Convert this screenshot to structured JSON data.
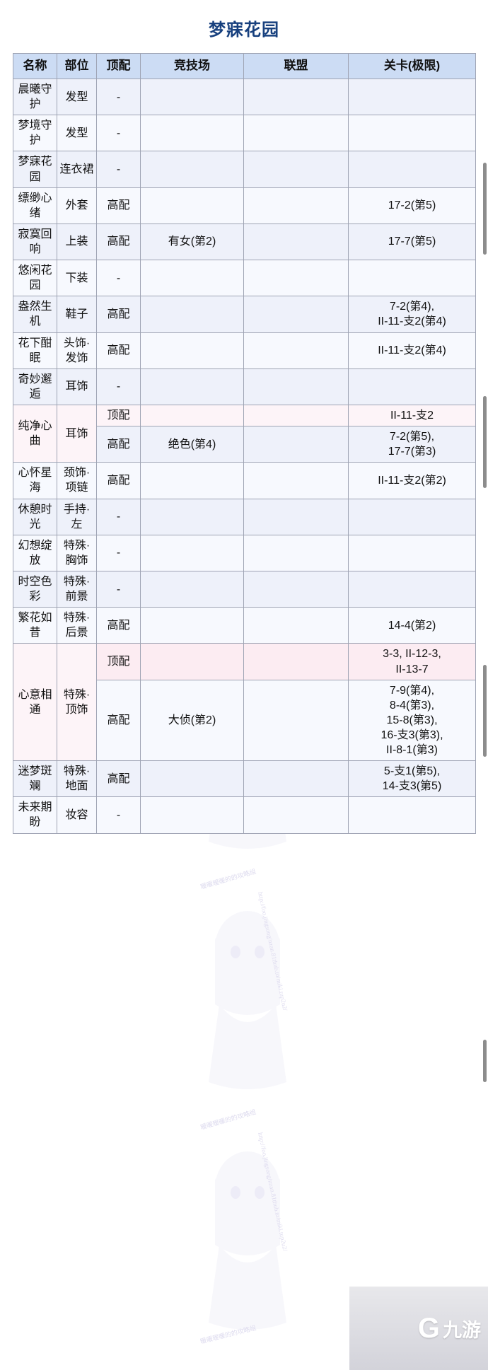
{
  "page": {
    "title": "梦寐花园",
    "title_color": "#17407e",
    "highlight_color": "#e8112d"
  },
  "table": {
    "headers": [
      "名称",
      "部位",
      "顶配",
      "竞技场",
      "联盟",
      "关卡(极限)"
    ],
    "rows": [
      {
        "name": "晨曦守护",
        "part": "发型",
        "top": "-",
        "arena": "",
        "league": "",
        "stage": ""
      },
      {
        "name": "梦境守护",
        "part": "发型",
        "top": "-",
        "arena": "",
        "league": "",
        "stage": ""
      },
      {
        "name": "梦寐花园",
        "part": "连衣裙",
        "top": "-",
        "arena": "",
        "league": "",
        "stage": ""
      },
      {
        "name": "缥缈心绪",
        "part": "外套",
        "top": "高配",
        "arena": "",
        "league": "",
        "stage": "17-2(第5)"
      },
      {
        "name": "寂寞回响",
        "part": "上装",
        "top": "高配",
        "arena": "有女(第2)",
        "league": "",
        "stage": "17-7(第5)"
      },
      {
        "name": "悠闲花园",
        "part": "下装",
        "top": "-",
        "arena": "",
        "league": "",
        "stage": ""
      },
      {
        "name": "盎然生机",
        "part": "鞋子",
        "top": "高配",
        "arena": "",
        "league": "",
        "stage": "7-2(第4),\nII-11-支2(第4)"
      },
      {
        "name": "花下酣眠",
        "part": "头饰·发饰",
        "top": "高配",
        "arena": "",
        "league": "",
        "stage": "II-11-支2(第4)"
      },
      {
        "name": "奇妙邂逅",
        "part": "耳饰",
        "top": "-",
        "arena": "",
        "league": "",
        "stage": ""
      },
      {
        "name": "纯净心曲",
        "part": "耳饰",
        "highlight": true,
        "sub": [
          {
            "top": "顶配",
            "arena": "",
            "league": "",
            "stage": "II-11-支2",
            "highlight": true
          },
          {
            "top": "高配",
            "arena": "绝色(第4)",
            "league": "",
            "stage": "7-2(第5),\n17-7(第3)",
            "highlight": false
          }
        ]
      },
      {
        "name": "心怀星海",
        "part": "颈饰·项链",
        "top": "高配",
        "arena": "",
        "league": "",
        "stage": "II-11-支2(第2)"
      },
      {
        "name": "休憩时光",
        "part": "手持·左",
        "top": "-",
        "arena": "",
        "league": "",
        "stage": ""
      },
      {
        "name": "幻想绽放",
        "part": "特殊·胸饰",
        "top": "-",
        "arena": "",
        "league": "",
        "stage": ""
      },
      {
        "name": "时空色彩",
        "part": "特殊·前景",
        "top": "-",
        "arena": "",
        "league": "",
        "stage": ""
      },
      {
        "name": "繁花如昔",
        "part": "特殊·后景",
        "top": "高配",
        "arena": "",
        "league": "",
        "stage": "14-4(第2)"
      },
      {
        "name": "心意相通",
        "part": "特殊·顶饰",
        "highlight": true,
        "sub": [
          {
            "top": "顶配",
            "arena": "",
            "league": "",
            "stage": "3-3, II-12-3,\nII-13-7",
            "highlight": true
          },
          {
            "top": "高配",
            "arena": "大侦(第2)",
            "league": "",
            "stage": "7-9(第4),\n8-4(第3),\n15-8(第3),\n16-支3(第3),\nII-8-1(第3)",
            "highlight": false
          }
        ]
      },
      {
        "name": "迷梦斑斓",
        "part": "特殊·地面",
        "top": "高配",
        "arena": "",
        "league": "",
        "stage": "5-支1(第5),\n14-支3(第5)"
      },
      {
        "name": "未来期盼",
        "part": "妆容",
        "top": "-",
        "arena": "",
        "league": "",
        "stage": ""
      }
    ]
  },
  "watermark": {
    "texts": [
      "暖暖暖暖的的攻略组",
      "http://foo.jingsong/nzan.81thub.to/miki.tup2u2/"
    ]
  },
  "brand": {
    "glyph": "G",
    "label": "九游"
  }
}
